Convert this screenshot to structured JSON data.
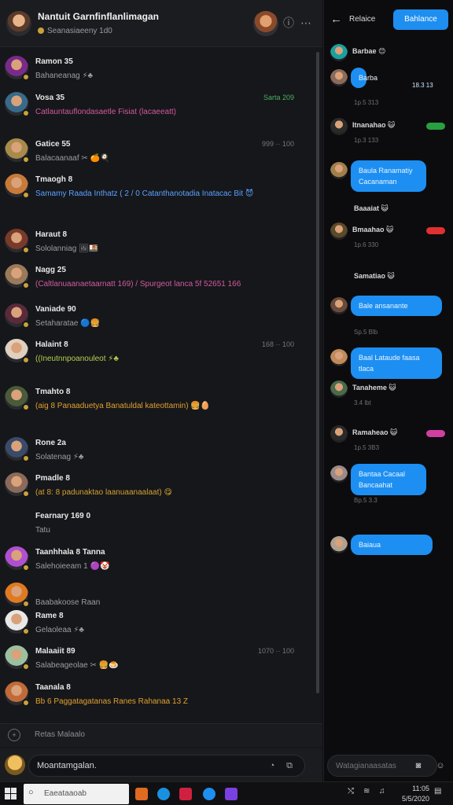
{
  "header": {
    "title": "Nantuit Garnfinflanlimagan",
    "subtitle": "Seanasiaeeny 1d0"
  },
  "messages": [
    {
      "name": "Ramon 35",
      "text": "Bahaneanag ⚡♣",
      "time": "",
      "avatar": "#7a2a8a"
    },
    {
      "name": "Vosa 35",
      "text": "Catlauntauflondasaetle Fisiat (lacaeeatt)",
      "time": "Sarta 209",
      "avatar": "#3a6a8a"
    },
    {
      "name": "Gatice 55",
      "text": "Balacaanaaf ✂ 🍊🍳",
      "time": "999 ·· 100",
      "avatar": "#a88a4a"
    },
    {
      "name": "Tmaogh 8",
      "text": "Samamy Raada Inthatz ( 2 / 0 Catanthanotadia Inatacac Bit 😈",
      "time": "",
      "avatar": "#c87a3a"
    },
    {
      "name": "Haraut 8",
      "text": "Sololanniag 🖼🍱",
      "time": "",
      "avatar": "#7a3a2a"
    },
    {
      "name": "Nagg 25",
      "text": "(Caltlanuaanaetaarnatt 169) / Spurgeot lanca 5f 52651 166",
      "time": "",
      "avatar": "#9a7a5a"
    },
    {
      "name": "Vaniade 90",
      "text": "Setaharatae 🔵🍔",
      "time": "",
      "avatar": "#5a2a3a"
    },
    {
      "name": "Halaint 8",
      "text": "((Ineutnnpoanouleot ⚡♣",
      "time": "168 ·· 100",
      "avatar": "#e0d0c0"
    },
    {
      "name": "Tmahto 8",
      "text": "(aig 8 Panaaduetya Banatuldal kateottamin) 🍔🥚",
      "time": "",
      "avatar": "#4a5a3a"
    },
    {
      "name": "Rone 2a",
      "text": "Solatenag ⚡♣",
      "time": "",
      "avatar": "#3a4a6a"
    },
    {
      "name": "Pmadle 8",
      "text": "(at 8: 8 padunaktao laanuaanaalaat) 😋",
      "time": "",
      "avatar": "#8a6a5a"
    },
    {
      "name": "Fearnary 169 0",
      "text": "Tatu",
      "time": "",
      "avatar": ""
    },
    {
      "name": "Taanhhala 8 Tanna",
      "text": "Salehoieeam 1 🟣🤡",
      "time": "",
      "avatar": "#b050d0"
    },
    {
      "name": "",
      "text": "Baabakoose Raan",
      "time": "",
      "avatar": "#e07a20"
    },
    {
      "name": "Rame 8",
      "text": "Gelaoleaa ⚡♣",
      "time": "",
      "avatar": "#e8e8e8"
    },
    {
      "name": "Malaaiit 89",
      "text": "Salabeageolae ✂ 🍔🍮",
      "time": "1070 ·· 100",
      "avatar": "#9ac0a0"
    },
    {
      "name": "Taanala 8",
      "text": "Bb 6 Paggatagatanas Ranes Rahanaa 13 Z",
      "time": "",
      "avatar": "#c06a3a"
    }
  ],
  "left_sub": {
    "label": "Retas Malaalo"
  },
  "composer": {
    "value": "Moantamgalan."
  },
  "right": {
    "title": "Relaice",
    "button_label": "Bahlance",
    "items": [
      {
        "kind": "name",
        "name": "Barbae 😊",
        "meta": "",
        "avatar": "#1aa0a0"
      },
      {
        "kind": "bubble",
        "text": "Barba",
        "meta_right": "18.3 13",
        "meta": "1p.5 313",
        "avatar": "#8a6a5a"
      },
      {
        "kind": "name",
        "name": "Itnanahao 😺",
        "meta": "1p.3 133",
        "avatar": "#2a2a2a",
        "chip": "#28a040"
      },
      {
        "kind": "bubble",
        "text": "Baula Ranamatiy Cacanaman",
        "meta": "",
        "avatar": "#a0804a"
      },
      {
        "kind": "name",
        "name": "Baaaiat 😺",
        "meta": "",
        "avatar": ""
      },
      {
        "kind": "name",
        "name": "Bmaahao 😺",
        "meta": "1p.6 330",
        "avatar": "#5a4a2a",
        "chip": "#e03030"
      },
      {
        "kind": "name",
        "name": "Samatiao 😺",
        "meta": "",
        "avatar": ""
      },
      {
        "kind": "bubble",
        "text": "Bale ansanante",
        "meta": "Sp.5 Blb",
        "avatar": "#6a4a3a"
      },
      {
        "kind": "bubble",
        "text": "Baal Lataude faasa tlaca",
        "meta": "",
        "avatar": "#c08a5a"
      },
      {
        "kind": "name",
        "name": "Tanaheme 😺",
        "meta": "3.4 lbt",
        "avatar": "#4a6a4a"
      },
      {
        "kind": "name",
        "name": "Ramaheao 😺",
        "meta": "1p.5 3B3",
        "avatar": "#2a2a2a",
        "chip": "#d040a0"
      },
      {
        "kind": "bubble",
        "text": "Bantaa Cacaal Bancaahat",
        "meta": "Bp.5 3.3",
        "avatar": "#9a8a8a"
      },
      {
        "kind": "bubble",
        "text": "Baiaua",
        "meta": "",
        "avatar": "#b0a090"
      }
    ],
    "composer_placeholder": "Watagianaasatas"
  },
  "taskbar": {
    "search_placeholder": "Eaeataaoab",
    "clock_time": "11:05",
    "clock_date": "5/5/2020"
  },
  "colors": {
    "accent": "#1e8ef0",
    "bg_left": "#16171a",
    "bg_right": "#0c0c0e"
  }
}
